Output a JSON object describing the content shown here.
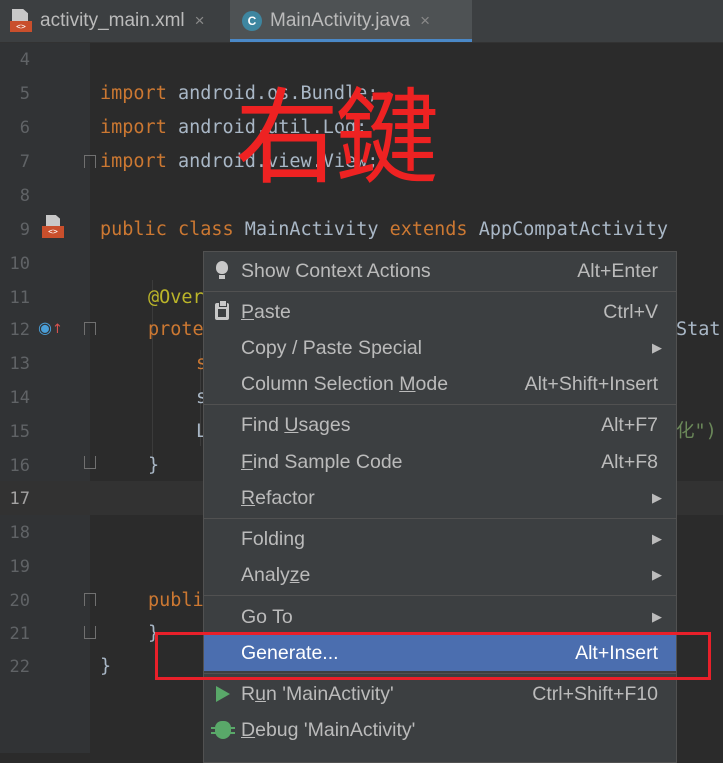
{
  "tabs": [
    {
      "label": "activity_main.xml",
      "icon": "xml-layout-icon",
      "badge": "<>",
      "close": "×",
      "active": false
    },
    {
      "label": "MainActivity.java",
      "icon": "java-class-icon",
      "badge": "C",
      "close": "×",
      "active": true
    }
  ],
  "editor": {
    "current_line": "17",
    "line_numbers": [
      "4",
      "5",
      "6",
      "7",
      "8",
      "9",
      "10",
      "11",
      "12",
      "13",
      "14",
      "15",
      "16",
      "17",
      "18",
      "19",
      "20",
      "21",
      "22"
    ],
    "code": {
      "l5_kw": "import",
      "l5_rest": " android.os.Bundle;",
      "l6_kw": "import",
      "l6_rest": " android.util.Log;",
      "l7_kw": "import",
      "l7_rest": " android.view.View;",
      "l9_kw1": "public",
      "l9_kw2": "class",
      "l9_name": " MainActivity ",
      "l9_kw3": "extends",
      "l9_rest": " AppCompatActivity",
      "l11": "@Over",
      "l12_a": "prote",
      "l12_b": "Stat",
      "l13": "s",
      "l14": "s",
      "l15_a": "L",
      "l15_b": "化\")",
      "l16": "}",
      "l20": "publi",
      "l21": "}",
      "l22": "}"
    },
    "gutter_badge": "<>"
  },
  "overlay_text": "右鍵",
  "context_menu": {
    "items": [
      {
        "label": "Show Context Actions",
        "shortcut": "Alt+Enter",
        "icon": "lightbulb-icon"
      },
      {
        "label_pre": "",
        "label_u": "P",
        "label_post": "aste",
        "shortcut": "Ctrl+V",
        "icon": "clipboard-icon"
      },
      {
        "label": "Copy / Paste Special",
        "submenu": "▶"
      },
      {
        "label_pre": "Column Selection ",
        "label_u": "M",
        "label_post": "ode",
        "shortcut": "Alt+Shift+Insert"
      },
      {
        "label_pre": "Find ",
        "label_u": "U",
        "label_post": "sages",
        "shortcut": "Alt+F7"
      },
      {
        "label_pre": "",
        "label_u": "F",
        "label_post": "ind Sample Code",
        "shortcut": "Alt+F8"
      },
      {
        "label_pre": "",
        "label_u": "R",
        "label_post": "efactor",
        "submenu": "▶"
      },
      {
        "label": "Folding",
        "submenu": "▶"
      },
      {
        "label_pre": "Analy",
        "label_u": "z",
        "label_post": "e",
        "submenu": "▶"
      },
      {
        "label": "Go To",
        "submenu": "▶"
      },
      {
        "label": "Generate...",
        "shortcut": "Alt+Insert",
        "highlighted": true
      },
      {
        "label_pre": "R",
        "label_u": "u",
        "label_post": "n 'MainActivity'",
        "shortcut": "Ctrl+Shift+F10",
        "icon": "run-icon"
      },
      {
        "label_pre": "",
        "label_u": "D",
        "label_post": "ebug 'MainActivity'",
        "icon": "debug-icon"
      }
    ]
  },
  "colors": {
    "editor_bg": "#2b2b2b",
    "keyword": "#cc7832",
    "menu_highlight": "#4b6eaf",
    "annotation_red": "#e8202a"
  }
}
